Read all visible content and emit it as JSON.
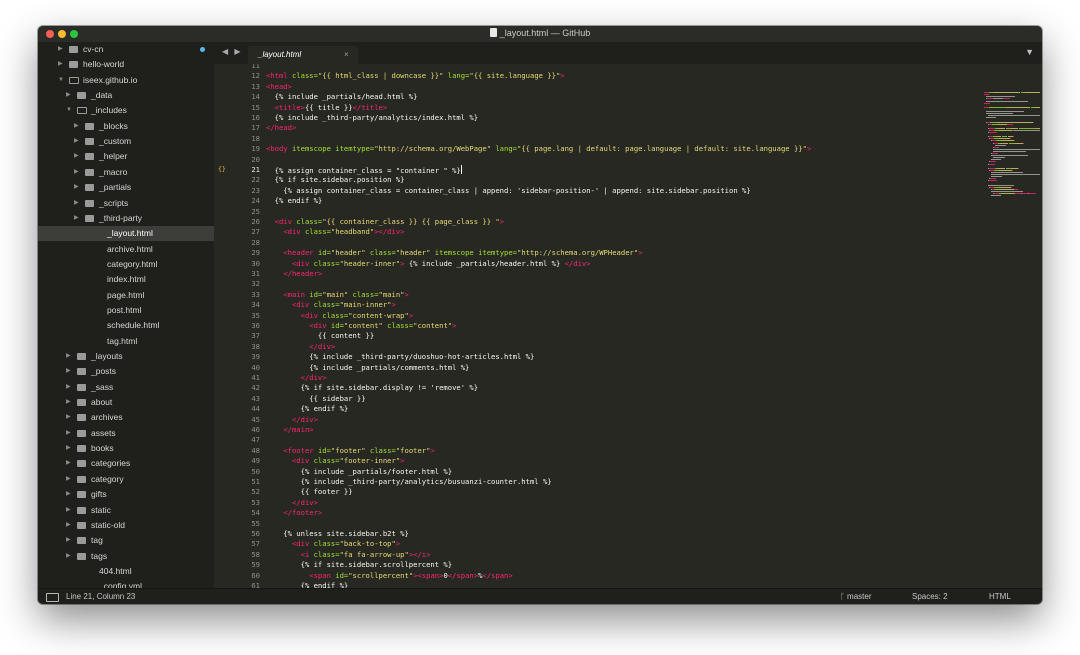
{
  "window": {
    "title": "_layout.html — GitHub"
  },
  "sidebar": {
    "items": [
      {
        "label": "cv-cn",
        "depth": 0,
        "type": "folder",
        "open": false,
        "indicator": true
      },
      {
        "label": "hello-world",
        "depth": 0,
        "type": "folder",
        "open": false
      },
      {
        "label": "iseex.github.io",
        "depth": 0,
        "type": "folder",
        "open": true
      },
      {
        "label": "_data",
        "depth": 1,
        "type": "folder",
        "open": false
      },
      {
        "label": "_includes",
        "depth": 1,
        "type": "folder",
        "open": true
      },
      {
        "label": "_blocks",
        "depth": 2,
        "type": "folder",
        "open": false
      },
      {
        "label": "_custom",
        "depth": 2,
        "type": "folder",
        "open": false
      },
      {
        "label": "_helper",
        "depth": 2,
        "type": "folder",
        "open": false
      },
      {
        "label": "_macro",
        "depth": 2,
        "type": "folder",
        "open": false
      },
      {
        "label": "_partials",
        "depth": 2,
        "type": "folder",
        "open": false
      },
      {
        "label": "_scripts",
        "depth": 2,
        "type": "folder",
        "open": false
      },
      {
        "label": "_third-party",
        "depth": 2,
        "type": "folder",
        "open": false
      },
      {
        "label": "_layout.html",
        "depth": 3,
        "type": "file",
        "selected": true
      },
      {
        "label": "archive.html",
        "depth": 3,
        "type": "file"
      },
      {
        "label": "category.html",
        "depth": 3,
        "type": "file"
      },
      {
        "label": "index.html",
        "depth": 3,
        "type": "file"
      },
      {
        "label": "page.html",
        "depth": 3,
        "type": "file"
      },
      {
        "label": "post.html",
        "depth": 3,
        "type": "file"
      },
      {
        "label": "schedule.html",
        "depth": 3,
        "type": "file"
      },
      {
        "label": "tag.html",
        "depth": 3,
        "type": "file"
      },
      {
        "label": "_layouts",
        "depth": 1,
        "type": "folder",
        "open": false
      },
      {
        "label": "_posts",
        "depth": 1,
        "type": "folder",
        "open": false
      },
      {
        "label": "_sass",
        "depth": 1,
        "type": "folder",
        "open": false
      },
      {
        "label": "about",
        "depth": 1,
        "type": "folder",
        "open": false
      },
      {
        "label": "archives",
        "depth": 1,
        "type": "folder",
        "open": false
      },
      {
        "label": "assets",
        "depth": 1,
        "type": "folder",
        "open": false
      },
      {
        "label": "books",
        "depth": 1,
        "type": "folder",
        "open": false
      },
      {
        "label": "categories",
        "depth": 1,
        "type": "folder",
        "open": false
      },
      {
        "label": "category",
        "depth": 1,
        "type": "folder",
        "open": false
      },
      {
        "label": "gifts",
        "depth": 1,
        "type": "folder",
        "open": false
      },
      {
        "label": "static",
        "depth": 1,
        "type": "folder",
        "open": false
      },
      {
        "label": "static-old",
        "depth": 1,
        "type": "folder",
        "open": false
      },
      {
        "label": "tag",
        "depth": 1,
        "type": "folder",
        "open": false
      },
      {
        "label": "tags",
        "depth": 1,
        "type": "folder",
        "open": false
      },
      {
        "label": "404.html",
        "depth": 2,
        "type": "file"
      },
      {
        "label": "_config.yml",
        "depth": 2,
        "type": "file"
      }
    ]
  },
  "tabs": {
    "nav_arrows": "◀ ▶",
    "items": [
      {
        "label": "_layout.html",
        "close": "×"
      }
    ],
    "dropdown": "▼"
  },
  "editor": {
    "first_line": 11,
    "current_line": 21,
    "fold_marker": "{}",
    "lines": [
      [
        [
          "",
          ""
        ]
      ],
      [
        [
          "tag",
          "<html "
        ],
        [
          "attr",
          "class="
        ],
        [
          "str",
          "\"{{ html_class | downcase }}\""
        ],
        [
          "attr",
          " lang="
        ],
        [
          "str",
          "\"{{ site.language }}\""
        ],
        [
          "tag",
          ">"
        ]
      ],
      [
        [
          "tag",
          "<head>"
        ]
      ],
      [
        [
          "plain",
          "  {% include _partials/head.html %}"
        ]
      ],
      [
        [
          "plain",
          "  "
        ],
        [
          "tag",
          "<title>"
        ],
        [
          "plain",
          "{{ title }}"
        ],
        [
          "tag",
          "</title>"
        ]
      ],
      [
        [
          "plain",
          "  {% include _third-party/analytics/index.html %}"
        ]
      ],
      [
        [
          "tag",
          "</head>"
        ]
      ],
      [
        [
          "",
          ""
        ]
      ],
      [
        [
          "tag",
          "<body "
        ],
        [
          "attr",
          "itemscope itemtype="
        ],
        [
          "str",
          "\"http://schema.org/WebPage\""
        ],
        [
          "attr",
          " lang="
        ],
        [
          "str",
          "\"{{ page.lang | default: page.language | default: site.language }}\""
        ],
        [
          "tag",
          ">"
        ]
      ],
      [
        [
          "",
          ""
        ]
      ],
      [
        [
          "plain",
          "  {% assign container_class = \"container \" %}"
        ],
        [
          "cursor",
          ""
        ]
      ],
      [
        [
          "plain",
          "  {% if site.sidebar.position %}"
        ]
      ],
      [
        [
          "plain",
          "    {% assign container_class = container_class | append: 'sidebar-position-' | append: site.sidebar.position %}"
        ]
      ],
      [
        [
          "plain",
          "  {% endif %}"
        ]
      ],
      [
        [
          "",
          ""
        ]
      ],
      [
        [
          "plain",
          "  "
        ],
        [
          "tag",
          "<div "
        ],
        [
          "attr",
          "class="
        ],
        [
          "str",
          "\"{{ container_class }} {{ page_class }} \""
        ],
        [
          "tag",
          ">"
        ]
      ],
      [
        [
          "plain",
          "    "
        ],
        [
          "tag",
          "<div "
        ],
        [
          "attr",
          "class="
        ],
        [
          "str",
          "\"headband\""
        ],
        [
          "tag",
          "></div>"
        ]
      ],
      [
        [
          "",
          ""
        ]
      ],
      [
        [
          "plain",
          "    "
        ],
        [
          "tag",
          "<header "
        ],
        [
          "attr",
          "id="
        ],
        [
          "str",
          "\"header\""
        ],
        [
          "attr",
          " class="
        ],
        [
          "str",
          "\"header\""
        ],
        [
          "attr",
          " itemscope itemtype="
        ],
        [
          "str",
          "\"http://schema.org/WPHeader\""
        ],
        [
          "tag",
          ">"
        ]
      ],
      [
        [
          "plain",
          "      "
        ],
        [
          "tag",
          "<div "
        ],
        [
          "attr",
          "class="
        ],
        [
          "str",
          "\"header-inner\""
        ],
        [
          "tag",
          "> "
        ],
        [
          "plain",
          "{% include _partials/header.html %} "
        ],
        [
          "tag",
          "</div>"
        ]
      ],
      [
        [
          "plain",
          "    "
        ],
        [
          "tag",
          "</header>"
        ]
      ],
      [
        [
          "",
          ""
        ]
      ],
      [
        [
          "plain",
          "    "
        ],
        [
          "tag",
          "<main "
        ],
        [
          "attr",
          "id="
        ],
        [
          "str",
          "\"main\""
        ],
        [
          "attr",
          " class="
        ],
        [
          "str",
          "\"main\""
        ],
        [
          "tag",
          ">"
        ]
      ],
      [
        [
          "plain",
          "      "
        ],
        [
          "tag",
          "<div "
        ],
        [
          "attr",
          "class="
        ],
        [
          "str",
          "\"main-inner\""
        ],
        [
          "tag",
          ">"
        ]
      ],
      [
        [
          "plain",
          "        "
        ],
        [
          "tag",
          "<div "
        ],
        [
          "attr",
          "class="
        ],
        [
          "str",
          "\"content-wrap\""
        ],
        [
          "tag",
          ">"
        ]
      ],
      [
        [
          "plain",
          "          "
        ],
        [
          "tag",
          "<div "
        ],
        [
          "attr",
          "id="
        ],
        [
          "str",
          "\"content\""
        ],
        [
          "attr",
          " class="
        ],
        [
          "str",
          "\"content\""
        ],
        [
          "tag",
          ">"
        ]
      ],
      [
        [
          "plain",
          "            {{ content }}"
        ]
      ],
      [
        [
          "plain",
          "          "
        ],
        [
          "tag",
          "</div>"
        ]
      ],
      [
        [
          "plain",
          "          {% include _third-party/duoshuo-hot-articles.html %}"
        ]
      ],
      [
        [
          "plain",
          "          {% include _partials/comments.html %}"
        ]
      ],
      [
        [
          "plain",
          "        "
        ],
        [
          "tag",
          "</div>"
        ]
      ],
      [
        [
          "plain",
          "        {% if site.sidebar.display != 'remove' %}"
        ]
      ],
      [
        [
          "plain",
          "          {{ sidebar }}"
        ]
      ],
      [
        [
          "plain",
          "        {% endif %}"
        ]
      ],
      [
        [
          "plain",
          "      "
        ],
        [
          "tag",
          "</div>"
        ]
      ],
      [
        [
          "plain",
          "    "
        ],
        [
          "tag",
          "</main>"
        ]
      ],
      [
        [
          "",
          ""
        ]
      ],
      [
        [
          "plain",
          "    "
        ],
        [
          "tag",
          "<footer "
        ],
        [
          "attr",
          "id="
        ],
        [
          "str",
          "\"footer\""
        ],
        [
          "attr",
          " class="
        ],
        [
          "str",
          "\"footer\""
        ],
        [
          "tag",
          ">"
        ]
      ],
      [
        [
          "plain",
          "      "
        ],
        [
          "tag",
          "<div "
        ],
        [
          "attr",
          "class="
        ],
        [
          "str",
          "\"footer-inner\""
        ],
        [
          "tag",
          ">"
        ]
      ],
      [
        [
          "plain",
          "        {% include _partials/footer.html %}"
        ]
      ],
      [
        [
          "plain",
          "        {% include _third-party/analytics/busuanzi-counter.html %}"
        ]
      ],
      [
        [
          "plain",
          "        {{ footer }}"
        ]
      ],
      [
        [
          "plain",
          "      "
        ],
        [
          "tag",
          "</div>"
        ]
      ],
      [
        [
          "plain",
          "    "
        ],
        [
          "tag",
          "</footer>"
        ]
      ],
      [
        [
          "",
          ""
        ]
      ],
      [
        [
          "plain",
          "    {% unless site.sidebar.b2t %}"
        ]
      ],
      [
        [
          "plain",
          "      "
        ],
        [
          "tag",
          "<div "
        ],
        [
          "attr",
          "class="
        ],
        [
          "str",
          "\"back-to-top\""
        ],
        [
          "tag",
          ">"
        ]
      ],
      [
        [
          "plain",
          "        "
        ],
        [
          "tag",
          "<i "
        ],
        [
          "attr",
          "class="
        ],
        [
          "str",
          "\"fa fa-arrow-up\""
        ],
        [
          "tag",
          "></i>"
        ]
      ],
      [
        [
          "plain",
          "        {% if site.sidebar.scrollpercent %}"
        ]
      ],
      [
        [
          "plain",
          "          "
        ],
        [
          "tag",
          "<span "
        ],
        [
          "attr",
          "id="
        ],
        [
          "str",
          "\"scrollpercent\""
        ],
        [
          "tag",
          "><span>"
        ],
        [
          "plain",
          "0"
        ],
        [
          "tag",
          "</span>"
        ],
        [
          "plain",
          "%"
        ],
        [
          "tag",
          "</span>"
        ]
      ],
      [
        [
          "plain",
          "        {% endif %}"
        ]
      ]
    ]
  },
  "statusbar": {
    "position": "Line 21, Column 23",
    "branch": "master",
    "spaces": "Spaces: 2",
    "syntax": "HTML"
  },
  "colors": {
    "background": "#272822",
    "sidebar": "#1f201b",
    "tag": "#f92672",
    "attribute": "#a6e22e",
    "string": "#e6db74",
    "text": "#f8f8f2",
    "line_number": "#8f908a"
  }
}
